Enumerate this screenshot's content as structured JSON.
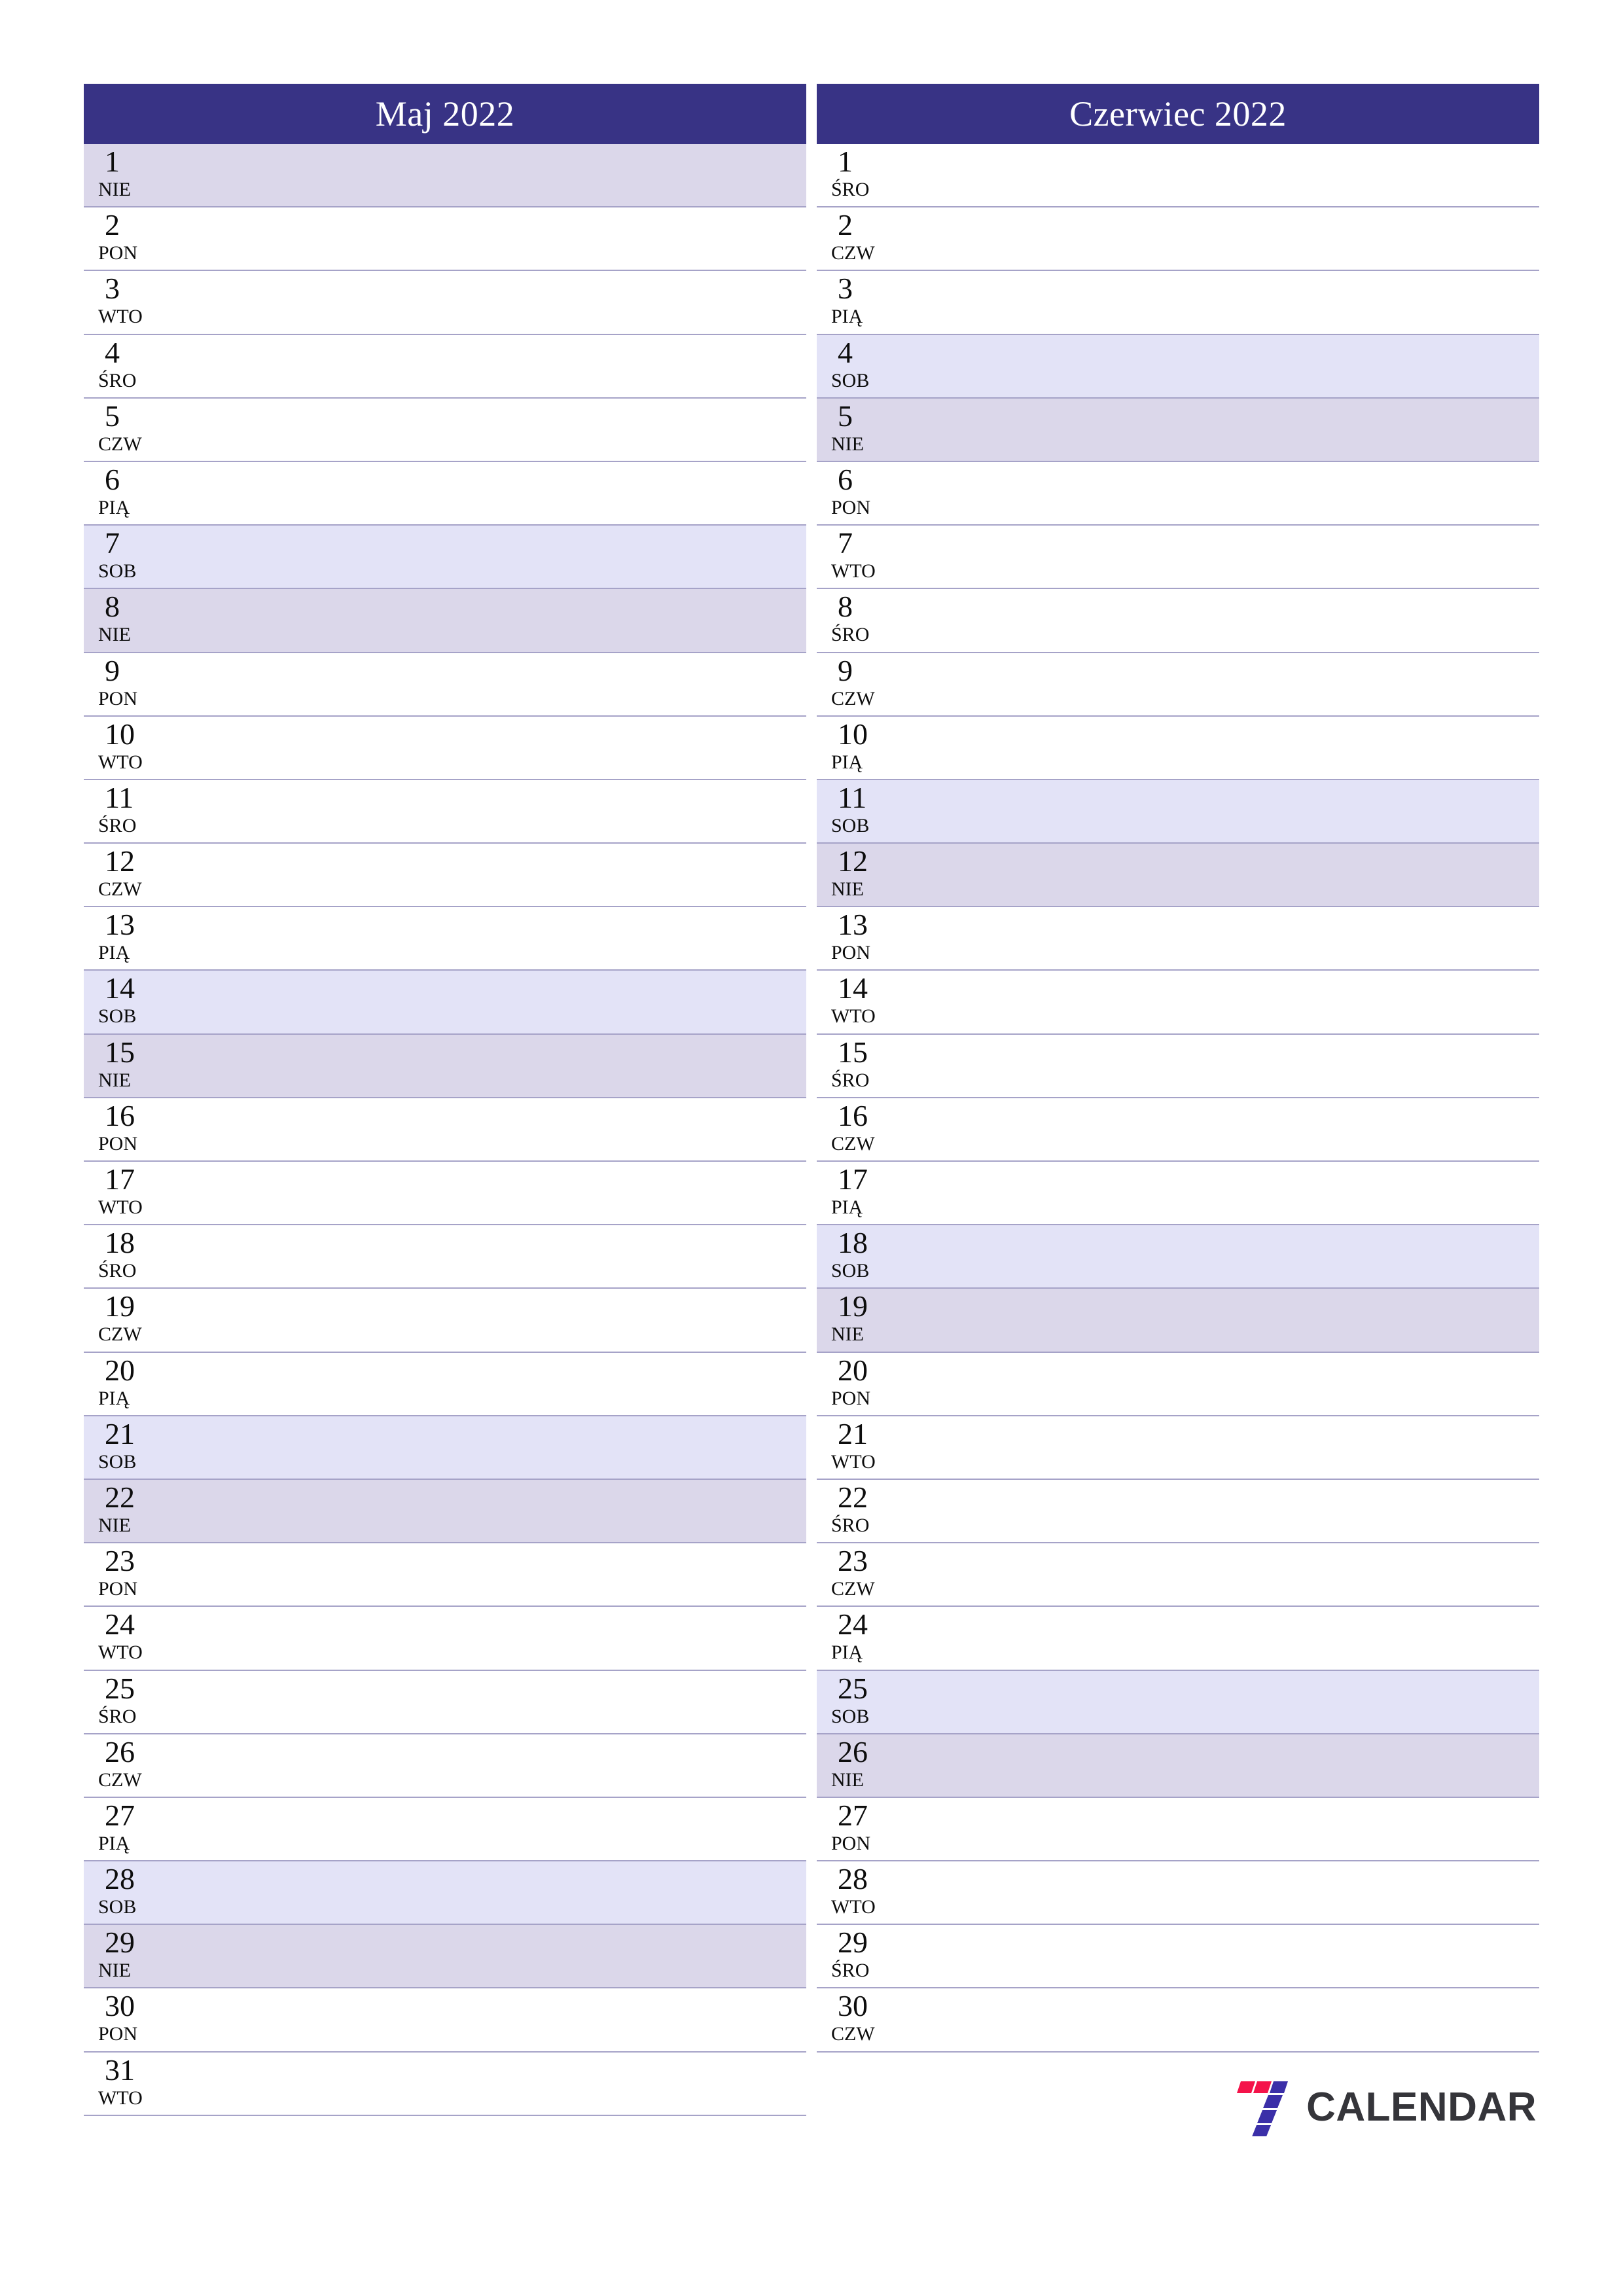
{
  "page": {
    "language": "pl",
    "accent_color": "#383385",
    "saturday_color": "#e3e3f7",
    "sunday_color": "#dbd7ea",
    "row_border_color": "#a6a3c8",
    "text_color": "#0d0d0d"
  },
  "months": [
    {
      "title": "Maj 2022",
      "days": [
        {
          "num": "1",
          "abbr": "NIE",
          "type": "sun"
        },
        {
          "num": "2",
          "abbr": "PON",
          "type": "weekday"
        },
        {
          "num": "3",
          "abbr": "WTO",
          "type": "weekday"
        },
        {
          "num": "4",
          "abbr": "ŚRO",
          "type": "weekday"
        },
        {
          "num": "5",
          "abbr": "CZW",
          "type": "weekday"
        },
        {
          "num": "6",
          "abbr": "PIĄ",
          "type": "weekday"
        },
        {
          "num": "7",
          "abbr": "SOB",
          "type": "sat"
        },
        {
          "num": "8",
          "abbr": "NIE",
          "type": "sun"
        },
        {
          "num": "9",
          "abbr": "PON",
          "type": "weekday"
        },
        {
          "num": "10",
          "abbr": "WTO",
          "type": "weekday"
        },
        {
          "num": "11",
          "abbr": "ŚRO",
          "type": "weekday"
        },
        {
          "num": "12",
          "abbr": "CZW",
          "type": "weekday"
        },
        {
          "num": "13",
          "abbr": "PIĄ",
          "type": "weekday"
        },
        {
          "num": "14",
          "abbr": "SOB",
          "type": "sat"
        },
        {
          "num": "15",
          "abbr": "NIE",
          "type": "sun"
        },
        {
          "num": "16",
          "abbr": "PON",
          "type": "weekday"
        },
        {
          "num": "17",
          "abbr": "WTO",
          "type": "weekday"
        },
        {
          "num": "18",
          "abbr": "ŚRO",
          "type": "weekday"
        },
        {
          "num": "19",
          "abbr": "CZW",
          "type": "weekday"
        },
        {
          "num": "20",
          "abbr": "PIĄ",
          "type": "weekday"
        },
        {
          "num": "21",
          "abbr": "SOB",
          "type": "sat"
        },
        {
          "num": "22",
          "abbr": "NIE",
          "type": "sun"
        },
        {
          "num": "23",
          "abbr": "PON",
          "type": "weekday"
        },
        {
          "num": "24",
          "abbr": "WTO",
          "type": "weekday"
        },
        {
          "num": "25",
          "abbr": "ŚRO",
          "type": "weekday"
        },
        {
          "num": "26",
          "abbr": "CZW",
          "type": "weekday"
        },
        {
          "num": "27",
          "abbr": "PIĄ",
          "type": "weekday"
        },
        {
          "num": "28",
          "abbr": "SOB",
          "type": "sat"
        },
        {
          "num": "29",
          "abbr": "NIE",
          "type": "sun"
        },
        {
          "num": "30",
          "abbr": "PON",
          "type": "weekday"
        },
        {
          "num": "31",
          "abbr": "WTO",
          "type": "weekday"
        }
      ]
    },
    {
      "title": "Czerwiec 2022",
      "days": [
        {
          "num": "1",
          "abbr": "ŚRO",
          "type": "weekday"
        },
        {
          "num": "2",
          "abbr": "CZW",
          "type": "weekday"
        },
        {
          "num": "3",
          "abbr": "PIĄ",
          "type": "weekday"
        },
        {
          "num": "4",
          "abbr": "SOB",
          "type": "sat"
        },
        {
          "num": "5",
          "abbr": "NIE",
          "type": "sun"
        },
        {
          "num": "6",
          "abbr": "PON",
          "type": "weekday"
        },
        {
          "num": "7",
          "abbr": "WTO",
          "type": "weekday"
        },
        {
          "num": "8",
          "abbr": "ŚRO",
          "type": "weekday"
        },
        {
          "num": "9",
          "abbr": "CZW",
          "type": "weekday"
        },
        {
          "num": "10",
          "abbr": "PIĄ",
          "type": "weekday"
        },
        {
          "num": "11",
          "abbr": "SOB",
          "type": "sat"
        },
        {
          "num": "12",
          "abbr": "NIE",
          "type": "sun"
        },
        {
          "num": "13",
          "abbr": "PON",
          "type": "weekday"
        },
        {
          "num": "14",
          "abbr": "WTO",
          "type": "weekday"
        },
        {
          "num": "15",
          "abbr": "ŚRO",
          "type": "weekday"
        },
        {
          "num": "16",
          "abbr": "CZW",
          "type": "weekday"
        },
        {
          "num": "17",
          "abbr": "PIĄ",
          "type": "weekday"
        },
        {
          "num": "18",
          "abbr": "SOB",
          "type": "sat"
        },
        {
          "num": "19",
          "abbr": "NIE",
          "type": "sun"
        },
        {
          "num": "20",
          "abbr": "PON",
          "type": "weekday"
        },
        {
          "num": "21",
          "abbr": "WTO",
          "type": "weekday"
        },
        {
          "num": "22",
          "abbr": "ŚRO",
          "type": "weekday"
        },
        {
          "num": "23",
          "abbr": "CZW",
          "type": "weekday"
        },
        {
          "num": "24",
          "abbr": "PIĄ",
          "type": "weekday"
        },
        {
          "num": "25",
          "abbr": "SOB",
          "type": "sat"
        },
        {
          "num": "26",
          "abbr": "NIE",
          "type": "sun"
        },
        {
          "num": "27",
          "abbr": "PON",
          "type": "weekday"
        },
        {
          "num": "28",
          "abbr": "WTO",
          "type": "weekday"
        },
        {
          "num": "29",
          "abbr": "ŚRO",
          "type": "weekday"
        },
        {
          "num": "30",
          "abbr": "CZW",
          "type": "weekday"
        }
      ]
    }
  ],
  "footer": {
    "logo_text": "CALENDAR",
    "logo_icon": "seven-logo-icon",
    "logo_red": "#f4134a",
    "logo_purple": "#3b2fa8",
    "logo_text_color": "#35353a"
  }
}
